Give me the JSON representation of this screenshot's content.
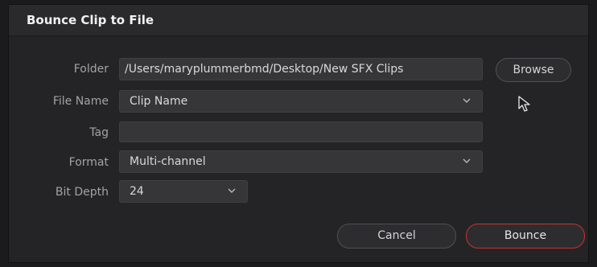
{
  "dialog": {
    "title": "Bounce Clip to File",
    "folder": {
      "label": "Folder",
      "value": "/Users/maryplummerbmd/Desktop/New SFX Clips",
      "browse_label": "Browse"
    },
    "file_name": {
      "label": "File Name",
      "value": "Clip Name"
    },
    "tag": {
      "label": "Tag",
      "value": ""
    },
    "format": {
      "label": "Format",
      "value": "Multi-channel"
    },
    "bit_depth": {
      "label": "Bit Depth",
      "value": "24"
    },
    "cancel_label": "Cancel",
    "bounce_label": "Bounce"
  },
  "colors": {
    "accent": "#c8322e",
    "background": "#242426"
  },
  "icons": [
    "chevron-down-icon",
    "mouse-pointer-icon"
  ]
}
